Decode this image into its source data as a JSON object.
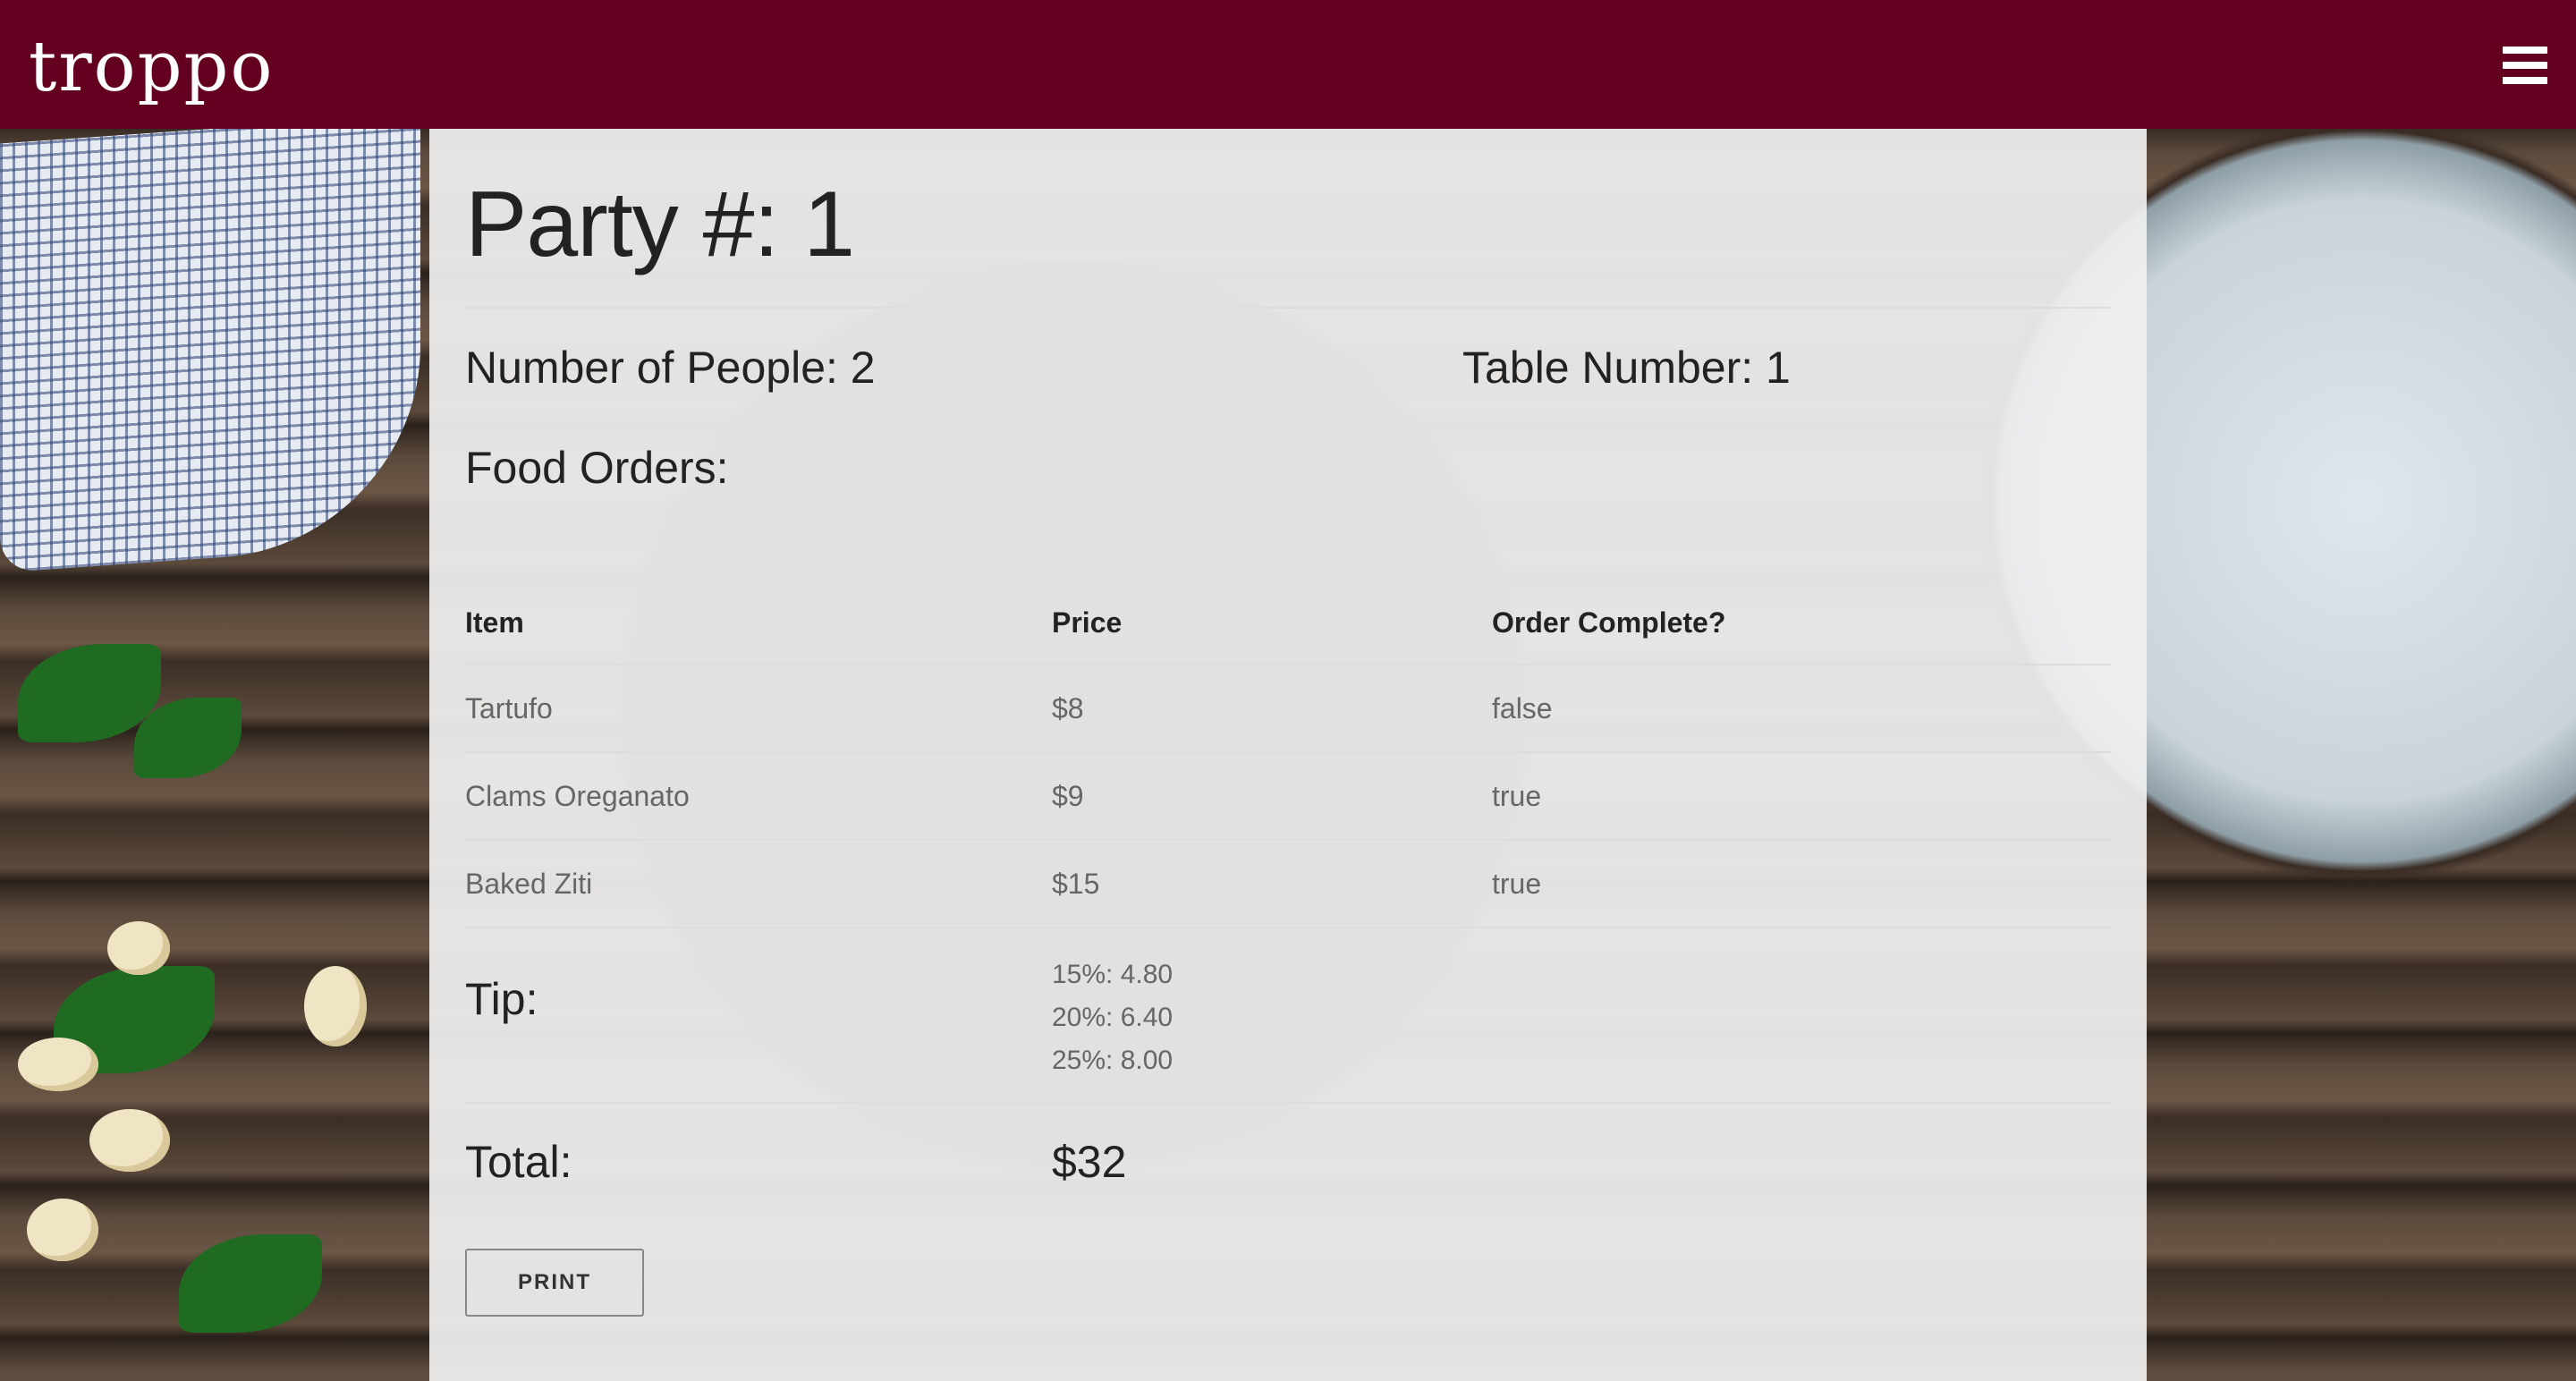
{
  "header": {
    "logo_text": "troppo",
    "menu_icon": "hamburger-menu-icon"
  },
  "party": {
    "title": "Party #: 1",
    "people": "Number of People: 2",
    "table": "Table Number: 1",
    "food_heading": "Food Orders:"
  },
  "orders": {
    "columns": [
      "Item",
      "Price",
      "Order Complete?"
    ],
    "rows": [
      {
        "item": "Tartufo",
        "price": "$8",
        "complete": "false"
      },
      {
        "item": "Clams Oreganato",
        "price": "$9",
        "complete": "true"
      },
      {
        "item": "Baked Ziti",
        "price": "$15",
        "complete": "true"
      }
    ]
  },
  "tip": {
    "label": "Tip:",
    "options": [
      "15%: 4.80",
      "20%: 6.40",
      "25%: 8.00"
    ]
  },
  "total": {
    "label": "Total:",
    "value": "$32"
  },
  "actions": {
    "print_label": "PRINT"
  },
  "colors": {
    "brand": "#63001f",
    "panel": "#f0f0f0"
  }
}
